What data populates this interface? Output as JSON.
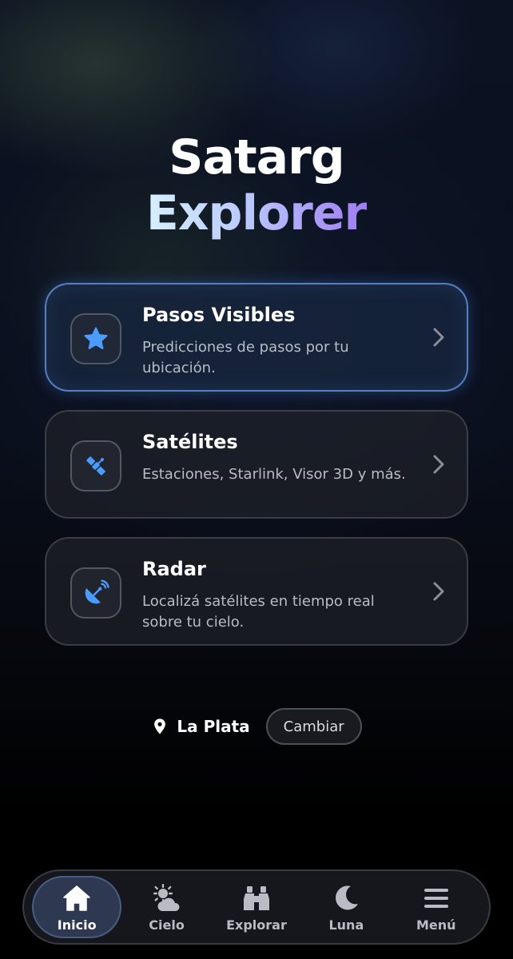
{
  "app": {
    "title_line1": "Satarg",
    "title_line2": "Explorer"
  },
  "cards": [
    {
      "title": "Pasos Visibles",
      "description": "Predicciones de pasos por tu ubicación.",
      "icon": "star-icon",
      "active": true
    },
    {
      "title": "Satélites",
      "description": "Estaciones, Starlink, Visor 3D y más.",
      "icon": "satellite-icon",
      "active": false
    },
    {
      "title": "Radar",
      "description": "Localizá satélites en tiempo real sobre tu cielo.",
      "icon": "radar-dish-icon",
      "active": false
    }
  ],
  "location": {
    "city": "La Plata",
    "change_label": "Cambiar",
    "icon": "location-pin-icon"
  },
  "nav": [
    {
      "label": "Inicio",
      "icon": "home-icon",
      "active": true
    },
    {
      "label": "Cielo",
      "icon": "weather-sun-cloud-icon",
      "active": false
    },
    {
      "label": "Explorar",
      "icon": "binoculars-icon",
      "active": false
    },
    {
      "label": "Luna",
      "icon": "moon-icon",
      "active": false
    },
    {
      "label": "Menú",
      "icon": "menu-icon",
      "active": false
    }
  ],
  "colors": {
    "accent_blue": "#4a9cff",
    "title_gradient_start": "#d8f0ff",
    "title_gradient_end": "#a07cf0"
  }
}
